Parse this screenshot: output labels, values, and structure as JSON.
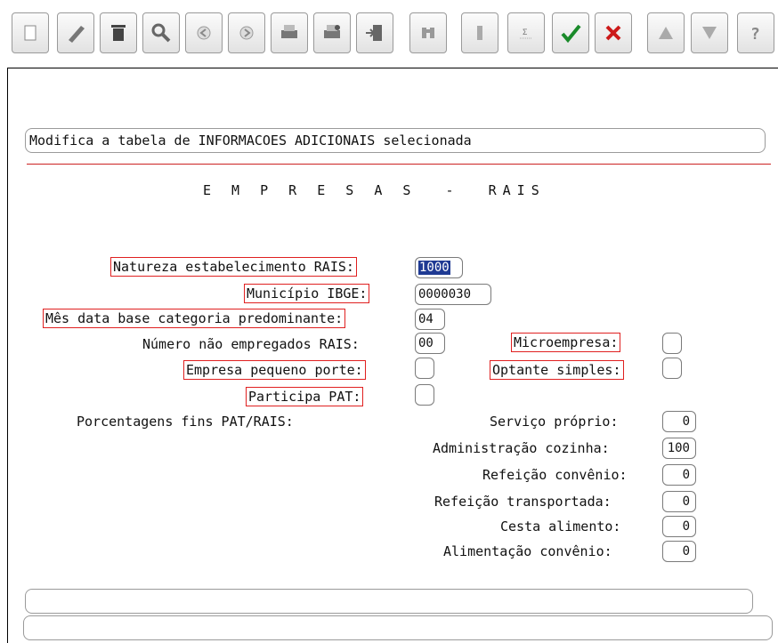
{
  "toolbar": {
    "buttons": [
      {
        "name": "new-icon"
      },
      {
        "name": "edit-icon"
      },
      {
        "name": "delete-icon"
      },
      {
        "name": "search-icon"
      },
      {
        "name": "previous-icon"
      },
      {
        "name": "next-icon"
      },
      {
        "name": "print-icon"
      },
      {
        "name": "print-preview-icon"
      },
      {
        "name": "exit-icon"
      },
      {
        "name": "binoculars-icon"
      },
      {
        "name": "one-icon"
      },
      {
        "name": "sum-icon"
      },
      {
        "name": "confirm-icon"
      },
      {
        "name": "cancel-icon"
      },
      {
        "name": "up-icon"
      },
      {
        "name": "down-icon"
      },
      {
        "name": "help-icon"
      }
    ]
  },
  "message": "Modifica a tabela de INFORMACOES ADICIONAIS selecionada",
  "title": "E M P R E S A S  -  RAIS",
  "fields": {
    "natureza": {
      "label": "Natureza estabelecimento RAIS:",
      "value": "1000"
    },
    "municipio": {
      "label": "Município IBGE:",
      "value": "0000030"
    },
    "mes_data_base": {
      "label": "Mês data base categoria predominante:",
      "value": "04"
    },
    "nao_empregados": {
      "label": "Número não empregados RAIS:",
      "value": "00"
    },
    "microempresa": {
      "label": "Microempresa:",
      "value": ""
    },
    "pequeno_porte": {
      "label": "Empresa pequeno porte:",
      "value": ""
    },
    "optante_simples": {
      "label": "Optante simples:",
      "value": ""
    },
    "participa_pat": {
      "label": "Participa PAT:",
      "value": ""
    },
    "porcentagens": {
      "label": "Porcentagens fins PAT/RAIS:"
    },
    "servico_proprio": {
      "label": "Serviço próprio:",
      "value": "0"
    },
    "adm_cozinha": {
      "label": "Administração cozinha:",
      "value": "100"
    },
    "refeicao_convenio": {
      "label": "Refeição convênio:",
      "value": "0"
    },
    "refeicao_transportada": {
      "label": "Refeição transportada:",
      "value": "0"
    },
    "cesta_alimento": {
      "label": "Cesta alimento:",
      "value": "0"
    },
    "alimentacao_convenio": {
      "label": "Alimentação convênio:",
      "value": "0"
    }
  },
  "status": {
    "line1": "",
    "line2": ""
  },
  "colors": {
    "highlight_border": "#e02020",
    "separator": "#cc2222",
    "selection": "#1f3a93"
  }
}
